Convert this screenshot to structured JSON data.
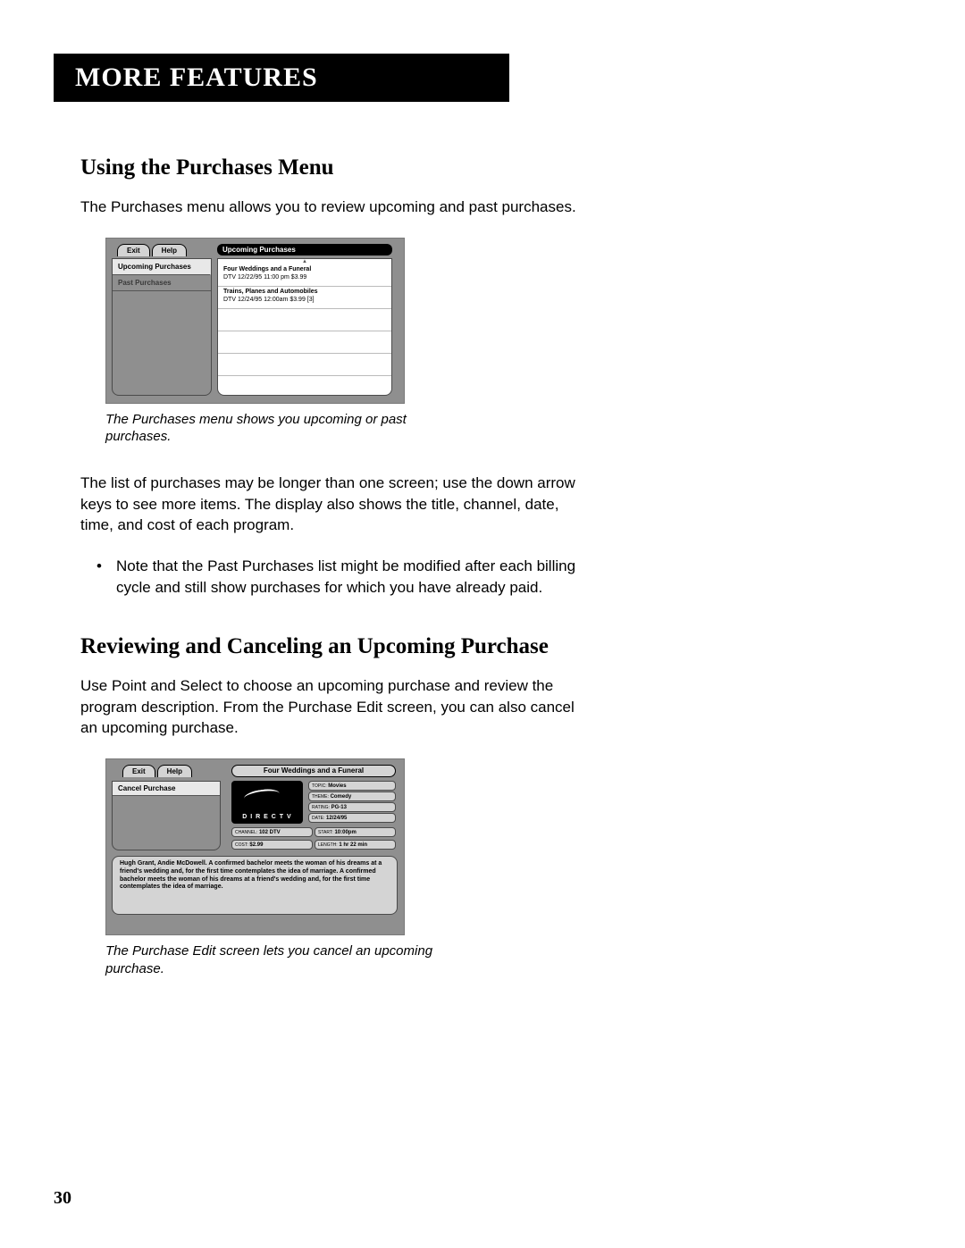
{
  "header": "MORE FEATURES",
  "section1": {
    "title": "Using the Purchases Menu",
    "intro": "The Purchases menu allows you to review upcoming and past purchases.",
    "caption": "The Purchases menu shows you upcoming or past purchases.",
    "para2": "The list of purchases may be longer than one screen; use the down arrow keys to see more items. The display also shows the title, channel, date, time, and cost of each program.",
    "bullet": "Note that the Past Purchases list might be modified after each billing cycle and still show purchases for which you have already paid."
  },
  "shot1": {
    "tabs": {
      "exit": "Exit",
      "help": "Help"
    },
    "heading": "Upcoming Purchases",
    "sidebar": {
      "upcoming": "Upcoming Purchases",
      "past": "Past Purchases"
    },
    "rows": [
      {
        "title": "Four Weddings and a Funeral",
        "meta": "DTV    12/22/95  11:00 pm  $3.99"
      },
      {
        "title": "Trains, Planes and Automobiles",
        "meta": "DTV    12/24/95 12:00am $3.99  [3]"
      }
    ]
  },
  "section2": {
    "title": "Reviewing and Canceling an Upcoming Purchase",
    "intro": "Use Point and Select to choose an upcoming purchase and review the program description. From the Purchase Edit screen, you can also cancel an upcoming purchase.",
    "caption": "The Purchase Edit screen lets you cancel an upcoming purchase."
  },
  "shot2": {
    "tabs": {
      "exit": "Exit",
      "help": "Help"
    },
    "title": "Four Weddings and a Funeral",
    "cancel": "Cancel Purchase",
    "logo": "D I R E C T V",
    "meta": {
      "topic_lbl": "TOPIC:",
      "topic": "Movies",
      "theme_lbl": "THEME:",
      "theme": "Comedy",
      "rating_lbl": "RATING:",
      "rating": "PG-13",
      "date_lbl": "DATE:",
      "date": "12/24/95",
      "channel_lbl": "CHANNEL:",
      "channel": "102 DTV",
      "start_lbl": "START:",
      "start": "10:00pm",
      "cost_lbl": "COST:",
      "cost": "$2.99",
      "length_lbl": "LENGTH:",
      "length": "1 hr 22 min"
    },
    "desc": "Hugh Grant, Andie McDowell. A confirmed bachelor meets the woman of his dreams at a friend's wedding and, for the first time contemplates the idea of marriage. A confirmed bachelor meets the woman of his dreams at a friend's wedding and, for the first time contemplates the idea of marriage."
  },
  "page_number": "30"
}
